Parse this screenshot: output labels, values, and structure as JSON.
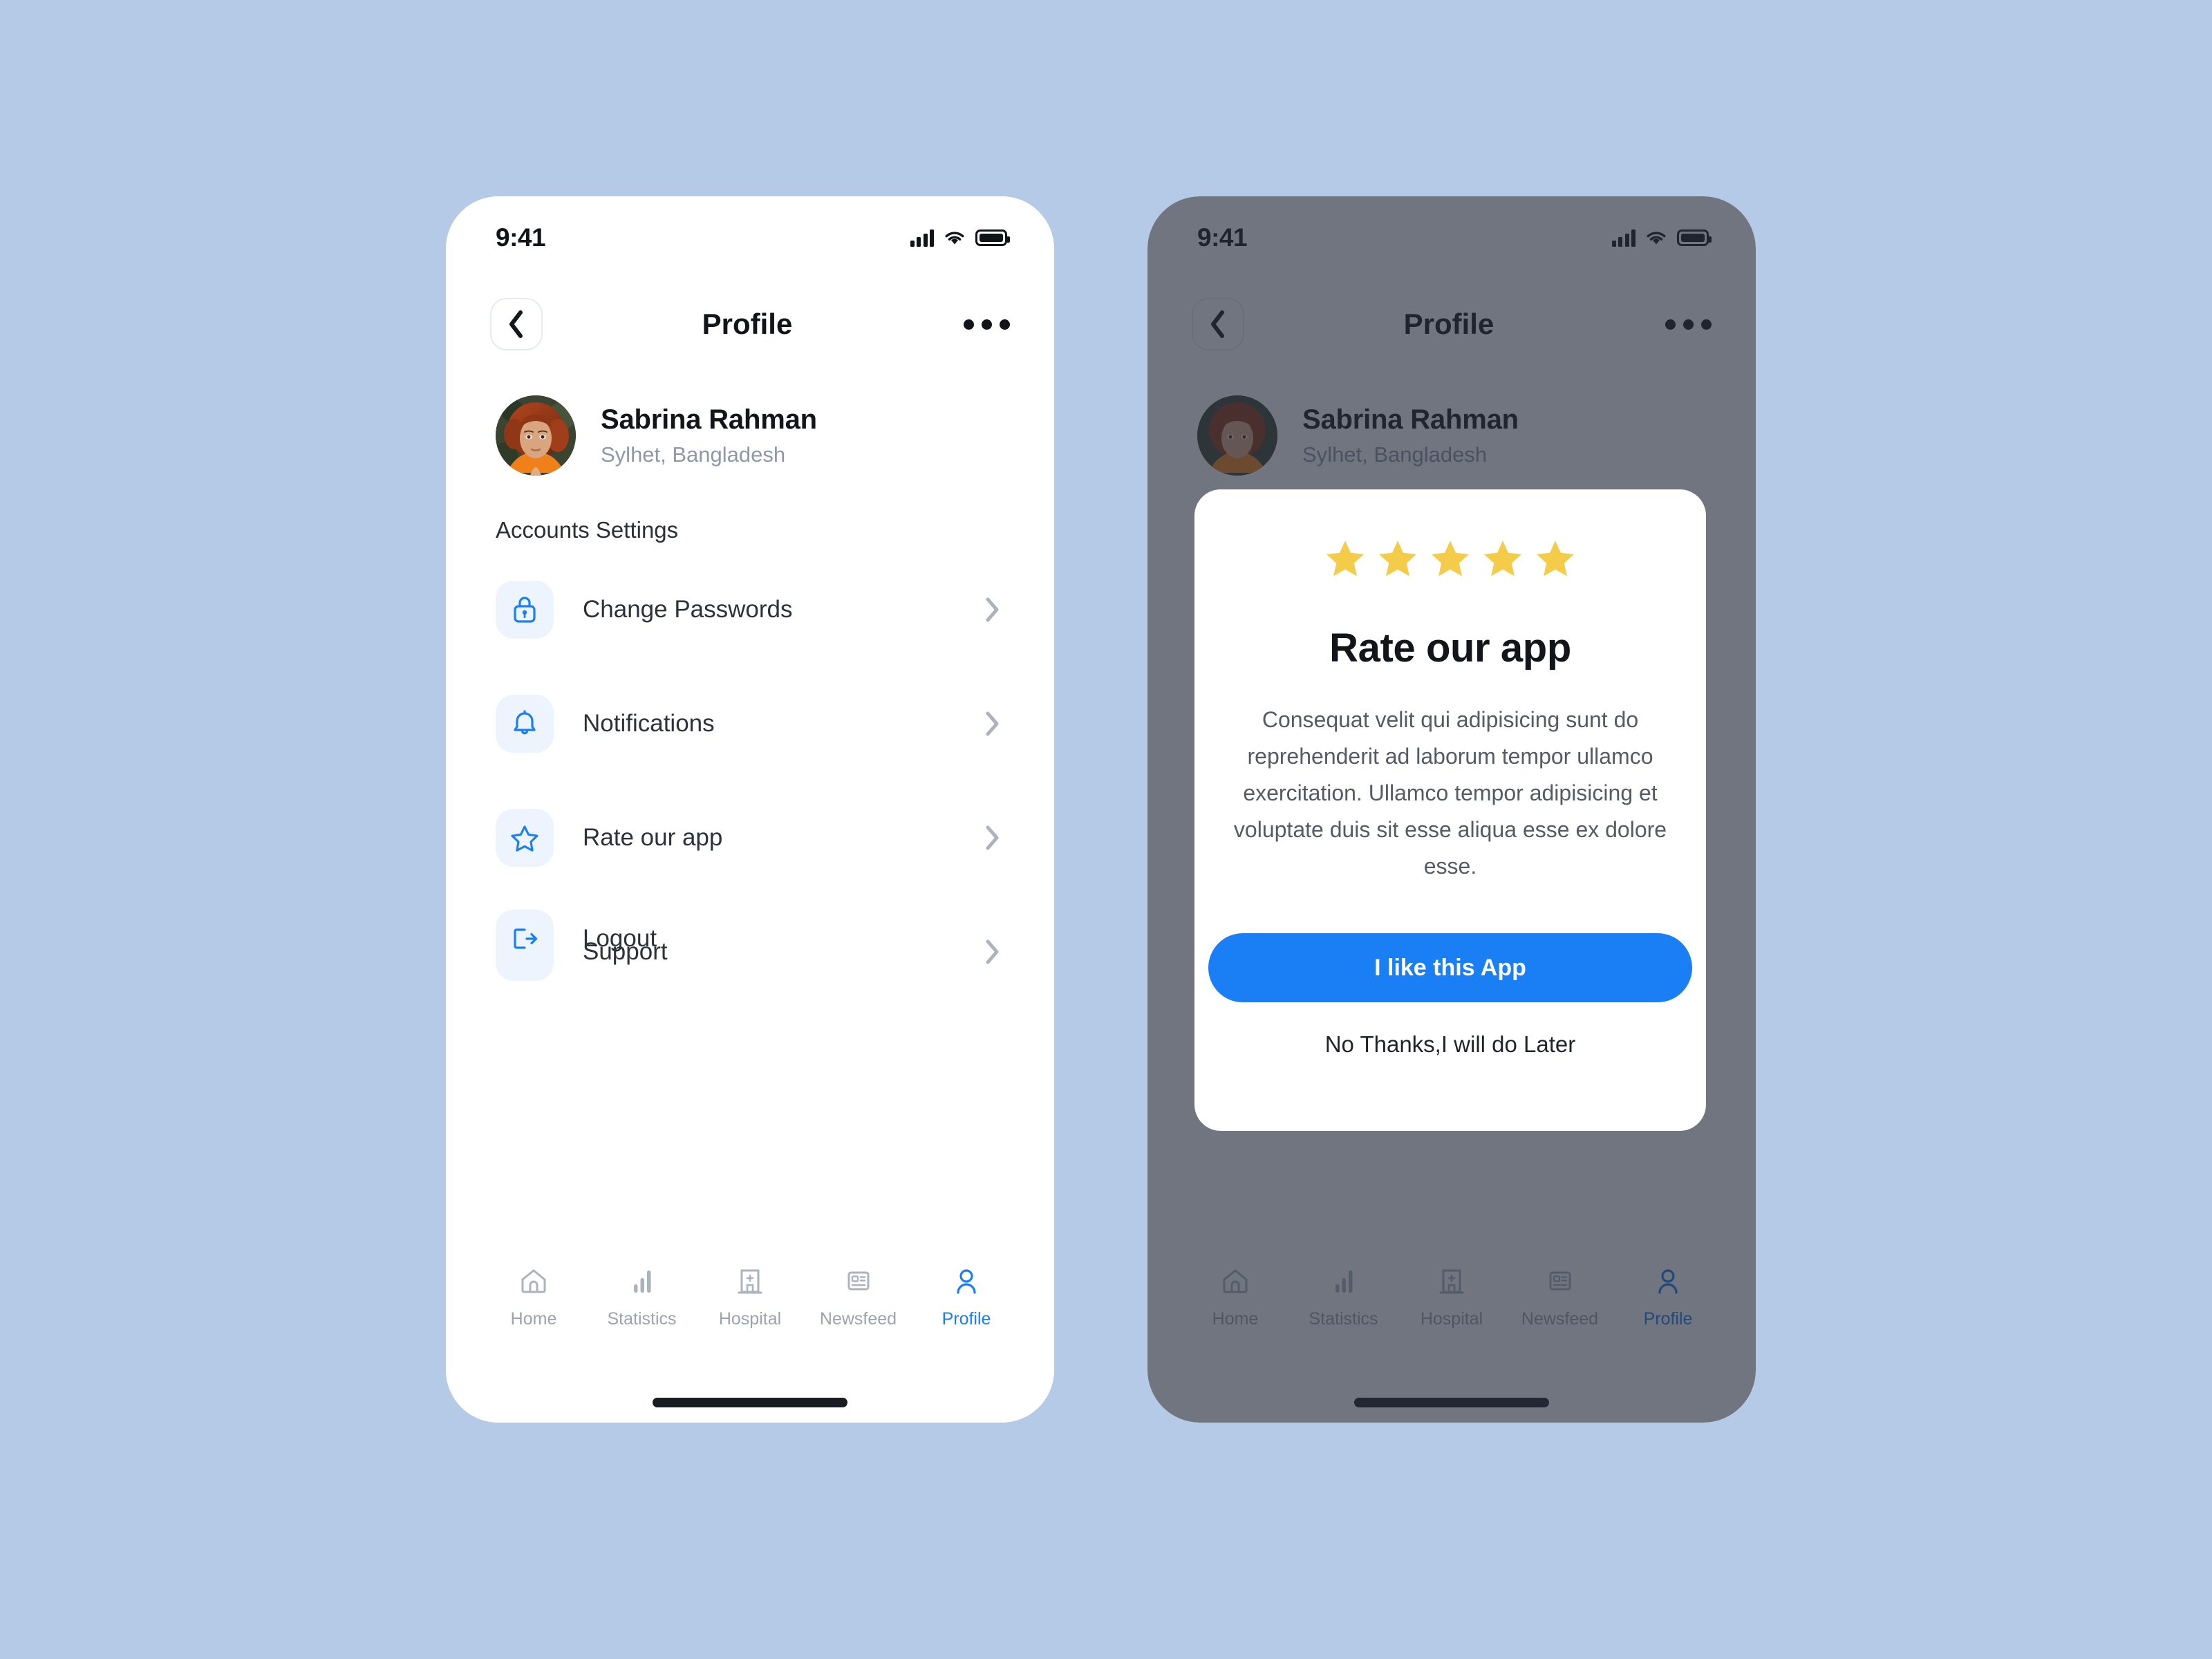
{
  "theme": {
    "page_background": "#b4cae6",
    "accent": "#1a7ff5",
    "star_color": "#f5cc4a",
    "icon_tile_background": "#eef4fd",
    "muted_text": "#8d98a9",
    "overlay": "rgba(40,46,60,0.66)"
  },
  "status_bar": {
    "time": "9:41",
    "signal_icon": "cellular-signal-icon",
    "wifi_icon": "wifi-icon",
    "battery_icon": "battery-icon"
  },
  "navbar": {
    "back_icon": "chevron-left-icon",
    "title": "Profile",
    "more_icon": "more-options-icon"
  },
  "profile": {
    "avatar_alt": "user-avatar",
    "name": "Sabrina Rahman",
    "location": "Sylhet, Bangladesh"
  },
  "settings": {
    "section_title": "Accounts Settings",
    "items": [
      {
        "label": "Change Passwords",
        "icon": "lock-icon",
        "chevron": "chevron-right-icon"
      },
      {
        "label": "Notifications",
        "icon": "bell-icon",
        "chevron": "chevron-right-icon"
      },
      {
        "label": "Rate our app",
        "icon": "star-outline-icon",
        "chevron": "chevron-right-icon"
      },
      {
        "label": "Support",
        "icon": "user-icon",
        "chevron": "chevron-right-icon"
      }
    ],
    "logout": {
      "label": "Logout",
      "icon": "logout-icon"
    }
  },
  "tabbar": {
    "items": [
      {
        "label": "Home",
        "icon": "home-icon",
        "active": false
      },
      {
        "label": "Statistics",
        "icon": "bar-chart-icon",
        "active": false
      },
      {
        "label": "Hospital",
        "icon": "hospital-icon",
        "active": false
      },
      {
        "label": "Newsfeed",
        "icon": "newsfeed-icon",
        "active": false
      },
      {
        "label": "Profile",
        "icon": "profile-icon",
        "active": true
      }
    ]
  },
  "modal": {
    "rating_stars_filled": 5,
    "rating_stars_total": 5,
    "title": "Rate our app",
    "body": "Consequat velit qui adipisicing sunt do reprehenderit ad laborum tempor ullamco exercitation. Ullamco tempor adipisicing et voluptate duis sit esse aliqua esse ex dolore esse.",
    "primary_button": "I like this App",
    "secondary_button": "No Thanks,I will do Later"
  }
}
